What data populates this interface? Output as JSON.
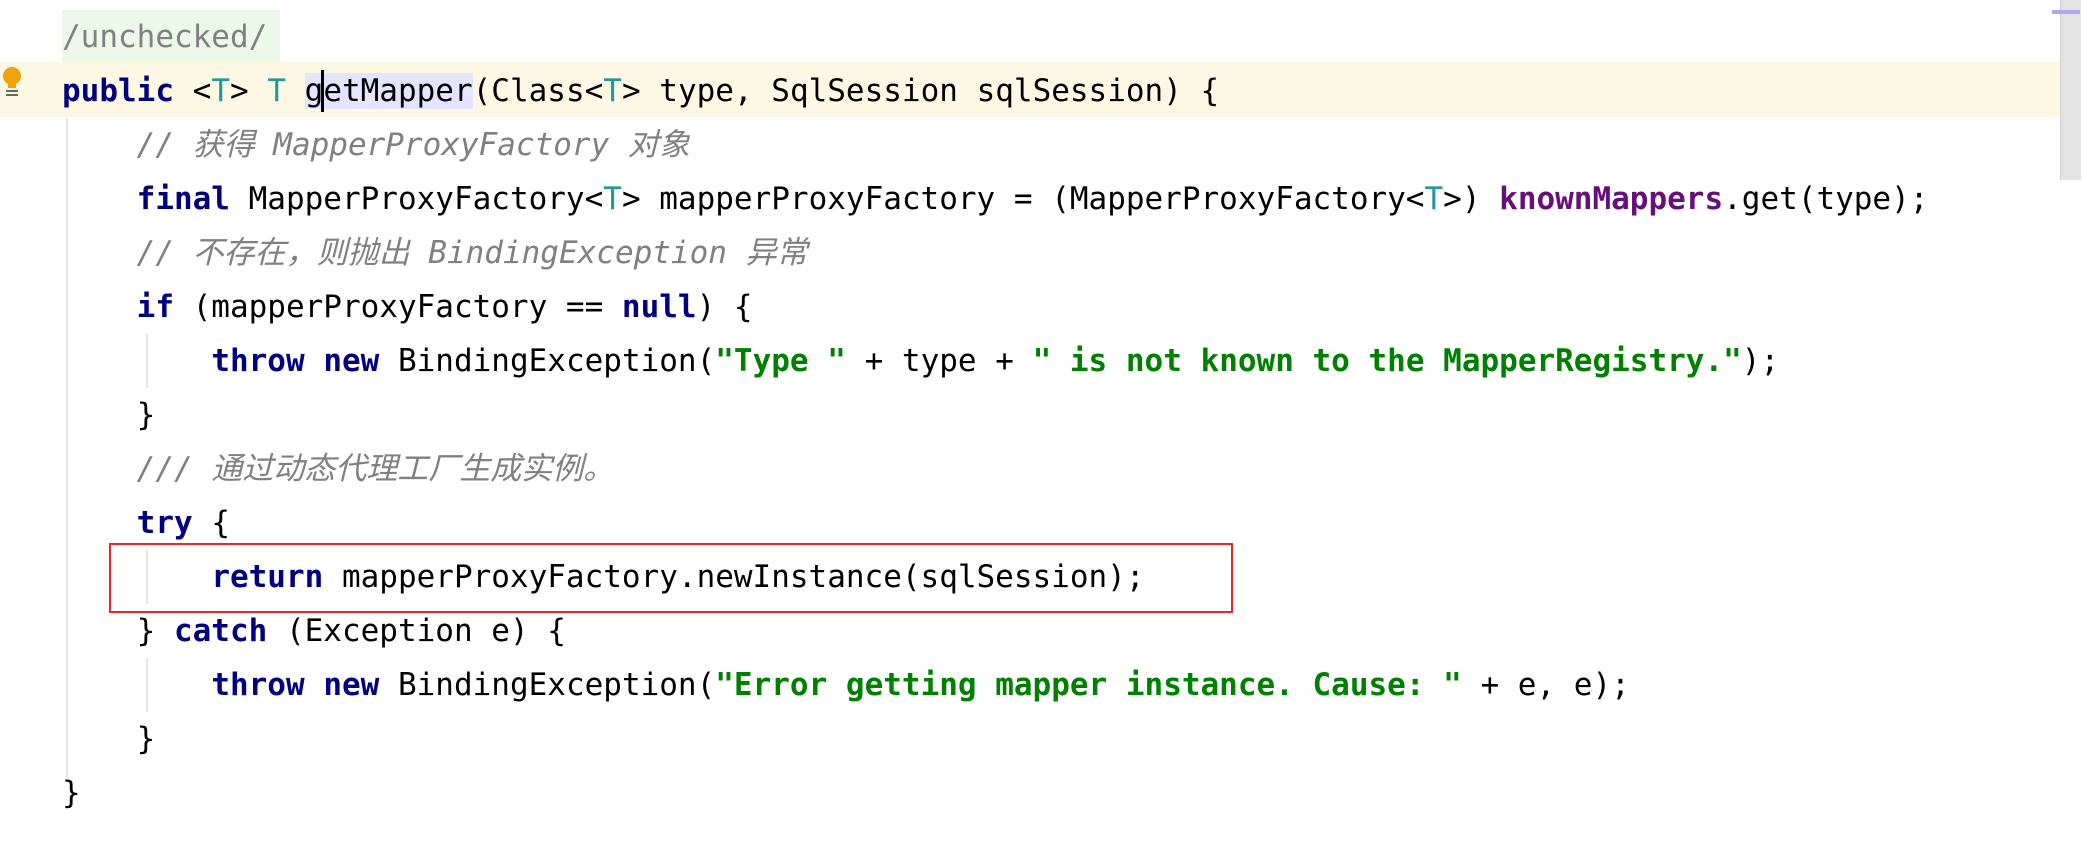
{
  "editor": {
    "colors": {
      "keyword": "#000080",
      "type_param": "#20999d",
      "comment": "#808080",
      "string": "#008000",
      "field": "#660e7a",
      "current_line": "#fdf8e4",
      "highlight_box": "#e8262e"
    },
    "gutter_icon": "intention-bulb-icon",
    "lines": [
      [
        {
          "t": "/unchecked/",
          "c": "an"
        }
      ],
      [
        {
          "t": "public",
          "c": "kw"
        },
        {
          "t": " <"
        },
        {
          "t": "T",
          "c": "tp"
        },
        {
          "t": "> "
        },
        {
          "t": "T",
          "c": "tp"
        },
        {
          "t": " "
        },
        {
          "t": "getMapper",
          "c": "hl"
        },
        {
          "t": "(Class<"
        },
        {
          "t": "T",
          "c": "tp"
        },
        {
          "t": "> type, SqlSession sqlSession) {"
        }
      ],
      [
        {
          "t": "    "
        },
        {
          "t": "// 获得 MapperProxyFactory 对象",
          "c": "cm"
        }
      ],
      [
        {
          "t": "    "
        },
        {
          "t": "final",
          "c": "kw"
        },
        {
          "t": " MapperProxyFactory<"
        },
        {
          "t": "T",
          "c": "tp"
        },
        {
          "t": "> mapperProxyFactory = (MapperProxyFactory<"
        },
        {
          "t": "T",
          "c": "tp"
        },
        {
          "t": ">) "
        },
        {
          "t": "knownMappers",
          "c": "fd"
        },
        {
          "t": ".get(type);"
        }
      ],
      [
        {
          "t": "    "
        },
        {
          "t": "// 不存在，则抛出 BindingException 异常",
          "c": "cm"
        }
      ],
      [
        {
          "t": "    "
        },
        {
          "t": "if",
          "c": "kw"
        },
        {
          "t": " (mapperProxyFactory == "
        },
        {
          "t": "null",
          "c": "kw"
        },
        {
          "t": ") {"
        }
      ],
      [
        {
          "t": "        "
        },
        {
          "t": "throw",
          "c": "kw"
        },
        {
          "t": " "
        },
        {
          "t": "new",
          "c": "kw"
        },
        {
          "t": " BindingException("
        },
        {
          "t": "\"Type \"",
          "c": "st"
        },
        {
          "t": " + type + "
        },
        {
          "t": "\" is not known to the MapperRegistry.\"",
          "c": "st"
        },
        {
          "t": ");"
        }
      ],
      [
        {
          "t": "    }"
        }
      ],
      [
        {
          "t": "    "
        },
        {
          "t": "/// 通过动态代理工厂生成实例。",
          "c": "cm"
        }
      ],
      [
        {
          "t": "    "
        },
        {
          "t": "try",
          "c": "kw"
        },
        {
          "t": " {"
        }
      ],
      [
        {
          "t": "        "
        },
        {
          "t": "return",
          "c": "kw"
        },
        {
          "t": " mapperProxyFactory.newInstance(sqlSession);"
        }
      ],
      [
        {
          "t": "    } "
        },
        {
          "t": "catch",
          "c": "kw"
        },
        {
          "t": " (Exception e) {"
        }
      ],
      [
        {
          "t": "        "
        },
        {
          "t": "throw",
          "c": "kw"
        },
        {
          "t": " "
        },
        {
          "t": "new",
          "c": "kw"
        },
        {
          "t": " BindingException("
        },
        {
          "t": "\"Error getting mapper instance. Cause: \"",
          "c": "st"
        },
        {
          "t": " + e, e);"
        }
      ],
      [
        {
          "t": "    }"
        }
      ],
      [
        {
          "t": "}"
        }
      ]
    ]
  }
}
